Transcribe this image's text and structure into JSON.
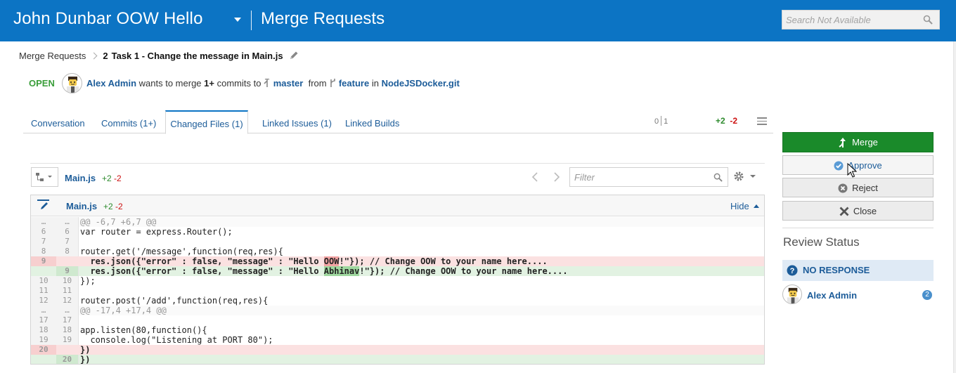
{
  "header": {
    "project_name": "John Dunbar OOW Hello",
    "page_title": "Merge Requests",
    "search_placeholder": "Search Not Available"
  },
  "breadcrumb": {
    "parent": "Merge Requests",
    "number": "2",
    "title": "Task 1 - Change the message in Main.js"
  },
  "merge_info": {
    "status": "OPEN",
    "author": "Alex Admin",
    "text_wants": "wants to merge",
    "commits_count": "1+",
    "text_commits_to": "commits to",
    "target_branch": "master",
    "text_from": "from",
    "source_branch": "feature",
    "text_in": "in",
    "repo": "NodeJSDocker.git"
  },
  "tabs": [
    {
      "label": "Conversation"
    },
    {
      "label": "Commits (1+)"
    },
    {
      "label": "Changed Files (1)"
    },
    {
      "label": "Linked Issues (1)"
    },
    {
      "label": "Linked Builds"
    }
  ],
  "tab_stats": {
    "seg_left": "0",
    "seg_right": "1",
    "added": "+2",
    "removed": "-2"
  },
  "files_toolbar": {
    "file_name": "Main.js",
    "added": "+2",
    "removed": "-2",
    "filter_placeholder": "Filter"
  },
  "diff": {
    "file_name": "Main.js",
    "added": "+2",
    "removed": "-2",
    "hide_label": "Hide",
    "lines": [
      {
        "type": "hunk",
        "old": "…",
        "new": "…",
        "code": "@@ -6,7 +6,7 @@"
      },
      {
        "type": "ctx",
        "old": "6",
        "new": "6",
        "code": "var router = express.Router();"
      },
      {
        "type": "ctx",
        "old": "7",
        "new": "7",
        "code": ""
      },
      {
        "type": "ctx",
        "old": "8",
        "new": "8",
        "code": "router.get('/message',function(req,res){"
      },
      {
        "type": "del",
        "old": "9",
        "new": "",
        "pre": "  res.json({\"error\" : false, \"message\" : \"Hello ",
        "hl": "OOW",
        "post": "!\"}); // Change OOW to your name here...."
      },
      {
        "type": "add",
        "old": "",
        "new": "9",
        "pre": "  res.json({\"error\" : false, \"message\" : \"Hello ",
        "hl": "Abhinav",
        "post": "!\"}); // Change OOW to your name here...."
      },
      {
        "type": "ctx",
        "old": "10",
        "new": "10",
        "code": "});"
      },
      {
        "type": "ctx",
        "old": "11",
        "new": "11",
        "code": ""
      },
      {
        "type": "ctx",
        "old": "12",
        "new": "12",
        "code": "router.post('/add',function(req,res){"
      },
      {
        "type": "hunk",
        "old": "…",
        "new": "…",
        "code": "@@ -17,4 +17,4 @@"
      },
      {
        "type": "ctx",
        "old": "17",
        "new": "17",
        "code": ""
      },
      {
        "type": "ctx",
        "old": "18",
        "new": "18",
        "code": "app.listen(80,function(){"
      },
      {
        "type": "ctx",
        "old": "19",
        "new": "19",
        "code": "  console.log(\"Listening at PORT 80\");"
      },
      {
        "type": "del",
        "old": "20",
        "new": "",
        "code": "})"
      },
      {
        "type": "add",
        "old": "",
        "new": "20",
        "code": "})"
      }
    ]
  },
  "actions": {
    "merge": "Merge",
    "approve": "Approve",
    "reject": "Reject",
    "close": "Close"
  },
  "review": {
    "title": "Review Status",
    "status": "NO RESPONSE",
    "reviewer": "Alex Admin",
    "count": "2"
  },
  "colors": {
    "header_bg": "#0c74c4",
    "link": "#1c5c99",
    "merge_button": "#1a8a2a",
    "added": "#2e8b2e",
    "removed": "#cc1111"
  }
}
